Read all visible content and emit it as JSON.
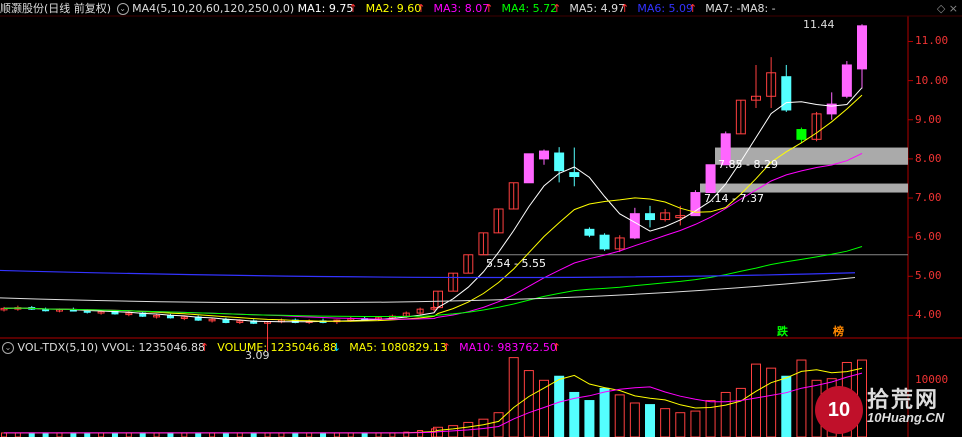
{
  "header": {
    "stock_name": "顺灏股份(日线 前复权)",
    "ma_set": "MA4(5,10,20,60,120,250,0,0)",
    "ma_items": [
      {
        "label": "MA1: 9.75",
        "color": "#ffffff",
        "arrow": "↑"
      },
      {
        "label": "MA2: 9.60",
        "color": "#ffff00",
        "arrow": "↑"
      },
      {
        "label": "MA3: 8.07",
        "color": "#ff00ff",
        "arrow": "↑"
      },
      {
        "label": "MA4: 5.72",
        "color": "#00ff00",
        "arrow": "↑"
      },
      {
        "label": "MA5: 4.97",
        "color": "#dddddd",
        "arrow": "↑"
      },
      {
        "label": "MA6: 5.09",
        "color": "#3333ff",
        "arrow": "↑"
      },
      {
        "label": "MA7: -",
        "color": "#dddddd",
        "arrow": ""
      },
      {
        "label": "MA8: -",
        "color": "#dddddd",
        "arrow": ""
      }
    ]
  },
  "volume_header": {
    "name": "VOL-TDX(5,10)",
    "items": [
      {
        "label": "VVOL: 1235046.88",
        "color": "#dddddd",
        "arrow": "↑"
      },
      {
        "label": "VOLUME: 1235046.88",
        "color": "#ffff00",
        "arrow": "↓"
      },
      {
        "label": "MA5: 1080829.13",
        "color": "#ffff00",
        "arrow": "↑"
      },
      {
        "label": "MA10: 983762.50",
        "color": "#ff00ff",
        "arrow": "↑"
      }
    ]
  },
  "y_axis": {
    "ticks": [
      "11.00",
      "10.00",
      "9.00",
      "8.00",
      "7.00",
      "6.00",
      "5.00",
      "4.00"
    ],
    "vol_tick": "10000"
  },
  "annotations": {
    "high": "11.44",
    "low": "3.09",
    "zone1": "7.85 - 8.29",
    "zone2": "7.14 - 7.37",
    "zone3": "5.54 - 5.55"
  },
  "signals": {
    "die": "跌",
    "bang": "榜"
  },
  "watermark": {
    "logo": "10",
    "cn": "拾荒网",
    "site": "10Huang.CN"
  },
  "colors": {
    "up": "#ff4040",
    "down": "#54ffff",
    "pink": "#ff66ff",
    "green": "#00ff00"
  },
  "chart_data": {
    "type": "candlestick",
    "ylim": [
      3.5,
      11.6
    ],
    "series": [
      {
        "name": "MA1",
        "color": "#ffffff"
      },
      {
        "name": "MA2",
        "color": "#ffff00"
      },
      {
        "name": "MA3",
        "color": "#ff00ff"
      },
      {
        "name": "MA4",
        "color": "#00ff00"
      },
      {
        "name": "MA5",
        "color": "#dddddd"
      },
      {
        "name": "MA6",
        "color": "#3333ff"
      }
    ],
    "candles": [
      {
        "o": 4.15,
        "h": 4.22,
        "l": 4.1,
        "c": 4.18
      },
      {
        "o": 4.18,
        "h": 4.25,
        "l": 4.12,
        "c": 4.2
      },
      {
        "o": 4.2,
        "h": 4.24,
        "l": 4.14,
        "c": 4.16
      },
      {
        "o": 4.16,
        "h": 4.2,
        "l": 4.1,
        "c": 4.12
      },
      {
        "o": 4.12,
        "h": 4.18,
        "l": 4.08,
        "c": 4.15
      },
      {
        "o": 4.15,
        "h": 4.2,
        "l": 4.1,
        "c": 4.12
      },
      {
        "o": 4.12,
        "h": 4.16,
        "l": 4.05,
        "c": 4.08
      },
      {
        "o": 4.08,
        "h": 4.14,
        "l": 4.02,
        "c": 4.1
      },
      {
        "o": 4.1,
        "h": 4.14,
        "l": 4.02,
        "c": 4.04
      },
      {
        "o": 4.04,
        "h": 4.1,
        "l": 3.98,
        "c": 4.06
      },
      {
        "o": 4.06,
        "h": 4.1,
        "l": 3.96,
        "c": 3.98
      },
      {
        "o": 3.98,
        "h": 4.05,
        "l": 3.92,
        "c": 4.0
      },
      {
        "o": 4.0,
        "h": 4.04,
        "l": 3.92,
        "c": 3.94
      },
      {
        "o": 3.94,
        "h": 4.0,
        "l": 3.88,
        "c": 3.96
      },
      {
        "o": 3.96,
        "h": 4.0,
        "l": 3.86,
        "c": 3.88
      },
      {
        "o": 3.88,
        "h": 3.94,
        "l": 3.82,
        "c": 3.9
      },
      {
        "o": 3.9,
        "h": 3.94,
        "l": 3.8,
        "c": 3.82
      },
      {
        "o": 3.82,
        "h": 3.9,
        "l": 3.78,
        "c": 3.86
      },
      {
        "o": 3.86,
        "h": 3.9,
        "l": 3.78,
        "c": 3.8
      },
      {
        "o": 3.8,
        "h": 3.86,
        "l": 3.09,
        "c": 3.84
      },
      {
        "o": 3.84,
        "h": 3.92,
        "l": 3.8,
        "c": 3.88
      },
      {
        "o": 3.88,
        "h": 3.92,
        "l": 3.8,
        "c": 3.82
      },
      {
        "o": 3.82,
        "h": 3.9,
        "l": 3.78,
        "c": 3.86
      },
      {
        "o": 3.86,
        "h": 3.92,
        "l": 3.8,
        "c": 3.84
      },
      {
        "o": 3.84,
        "h": 3.9,
        "l": 3.78,
        "c": 3.88
      },
      {
        "o": 3.88,
        "h": 3.96,
        "l": 3.84,
        "c": 3.92
      },
      {
        "o": 3.92,
        "h": 3.98,
        "l": 3.86,
        "c": 3.9
      },
      {
        "o": 3.9,
        "h": 3.98,
        "l": 3.86,
        "c": 3.94
      },
      {
        "o": 3.94,
        "h": 4.02,
        "l": 3.9,
        "c": 3.98
      },
      {
        "o": 3.98,
        "h": 4.1,
        "l": 3.94,
        "c": 4.06
      },
      {
        "o": 4.06,
        "h": 4.2,
        "l": 4.02,
        "c": 4.16
      },
      {
        "o": 4.16,
        "h": 4.24,
        "l": 4.1,
        "c": 4.2
      },
      {
        "o": 4.2,
        "h": 4.62,
        "l": 4.18,
        "c": 4.62
      },
      {
        "o": 4.62,
        "h": 5.08,
        "l": 4.62,
        "c": 5.08
      },
      {
        "o": 5.08,
        "h": 5.55,
        "l": 5.08,
        "c": 5.55
      },
      {
        "o": 5.55,
        "h": 6.11,
        "l": 5.55,
        "c": 6.11
      },
      {
        "o": 6.11,
        "h": 6.72,
        "l": 6.11,
        "c": 6.72
      },
      {
        "o": 6.72,
        "h": 7.39,
        "l": 6.72,
        "c": 7.39
      },
      {
        "o": 7.39,
        "h": 8.13,
        "l": 7.39,
        "c": 8.13
      },
      {
        "o": 8.0,
        "h": 8.24,
        "l": 7.85,
        "c": 8.2
      },
      {
        "o": 8.15,
        "h": 8.3,
        "l": 7.4,
        "c": 7.7
      },
      {
        "o": 7.65,
        "h": 8.29,
        "l": 7.3,
        "c": 7.55
      },
      {
        "o": 6.2,
        "h": 6.25,
        "l": 6.0,
        "c": 6.05
      },
      {
        "o": 6.05,
        "h": 6.1,
        "l": 5.65,
        "c": 5.7
      },
      {
        "o": 5.7,
        "h": 6.05,
        "l": 5.62,
        "c": 5.98
      },
      {
        "o": 5.98,
        "h": 6.75,
        "l": 5.95,
        "c": 6.6
      },
      {
        "o": 6.6,
        "h": 6.8,
        "l": 6.25,
        "c": 6.45
      },
      {
        "o": 6.45,
        "h": 6.72,
        "l": 6.4,
        "c": 6.62
      },
      {
        "o": 6.5,
        "h": 6.8,
        "l": 6.3,
        "c": 6.55
      },
      {
        "o": 6.55,
        "h": 7.2,
        "l": 6.55,
        "c": 7.14
      },
      {
        "o": 7.14,
        "h": 7.85,
        "l": 7.14,
        "c": 7.85
      },
      {
        "o": 7.85,
        "h": 8.7,
        "l": 7.85,
        "c": 8.64
      },
      {
        "o": 8.64,
        "h": 9.5,
        "l": 8.64,
        "c": 9.5
      },
      {
        "o": 9.5,
        "h": 10.4,
        "l": 9.3,
        "c": 9.6
      },
      {
        "o": 9.6,
        "h": 10.6,
        "l": 9.3,
        "c": 10.2
      },
      {
        "o": 10.1,
        "h": 10.4,
        "l": 9.2,
        "c": 9.25
      },
      {
        "o": 8.5,
        "h": 8.8,
        "l": 8.4,
        "c": 8.75
      },
      {
        "o": 8.5,
        "h": 9.2,
        "l": 8.45,
        "c": 9.15
      },
      {
        "o": 9.15,
        "h": 9.7,
        "l": 9.0,
        "c": 9.4
      },
      {
        "o": 9.6,
        "h": 10.5,
        "l": 9.55,
        "c": 10.4
      },
      {
        "o": 10.3,
        "h": 11.44,
        "l": 9.8,
        "c": 11.4
      }
    ]
  }
}
